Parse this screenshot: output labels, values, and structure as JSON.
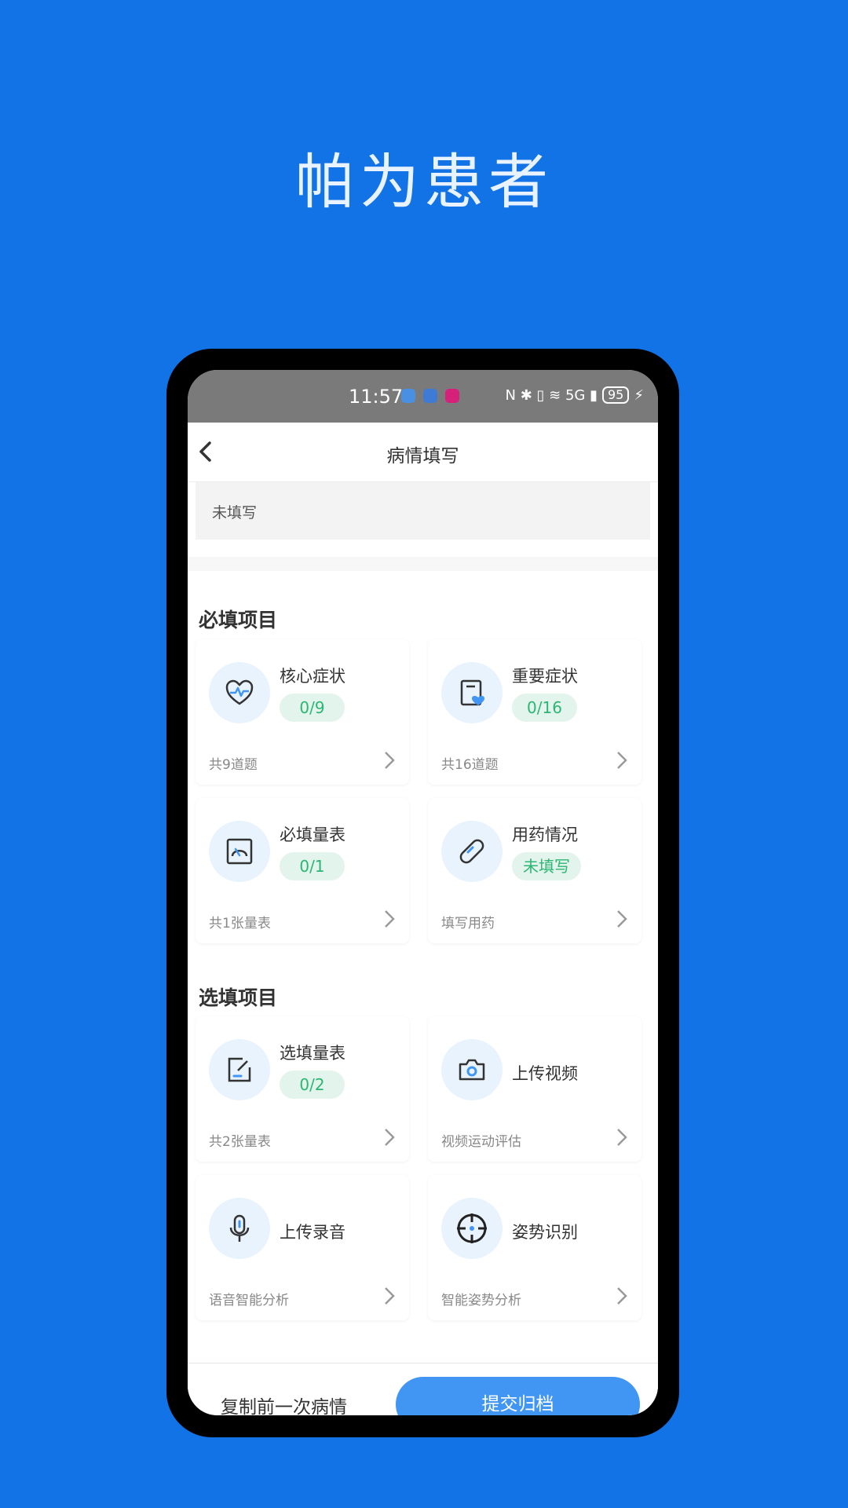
{
  "hero": {
    "title": "帕为患者"
  },
  "status_bar": {
    "time": "11:57",
    "right_text": "N ✱ ▯ ≋ 5G ▮",
    "battery": "95"
  },
  "nav": {
    "title": "病情填写",
    "back_icon": "back-chevron-icon"
  },
  "note": {
    "text": "未填写"
  },
  "required": {
    "title": "必填项目",
    "cards": [
      {
        "title": "核心症状",
        "badge": "0/9",
        "sub": "共9道题",
        "icon": "heartbeat-icon"
      },
      {
        "title": "重要症状",
        "badge": "0/16",
        "sub": "共16道题",
        "icon": "document-heart-icon"
      },
      {
        "title": "必填量表",
        "badge": "0/1",
        "sub": "共1张量表",
        "icon": "gauge-icon"
      },
      {
        "title": "用药情况",
        "badge": "未填写",
        "sub": "填写用药",
        "icon": "pill-icon"
      }
    ]
  },
  "optional": {
    "title": "选填项目",
    "cards": [
      {
        "title": "选填量表",
        "badge": "0/2",
        "sub": "共2张量表",
        "icon": "edit-scale-icon"
      },
      {
        "title": "上传视频",
        "sub": "视频运动评估",
        "icon": "camera-icon"
      },
      {
        "title": "上传录音",
        "sub": "语音智能分析",
        "icon": "microphone-icon"
      },
      {
        "title": "姿势识别",
        "sub": "智能姿势分析",
        "icon": "crosshair-icon"
      }
    ]
  },
  "bottom": {
    "copy_label": "复制前一次病情",
    "submit_label": "提交归档"
  },
  "colors": {
    "background": "#1173e6",
    "accent": "#4196f4",
    "badge_text": "#2bb673",
    "badge_bg": "#e3f4ec"
  }
}
